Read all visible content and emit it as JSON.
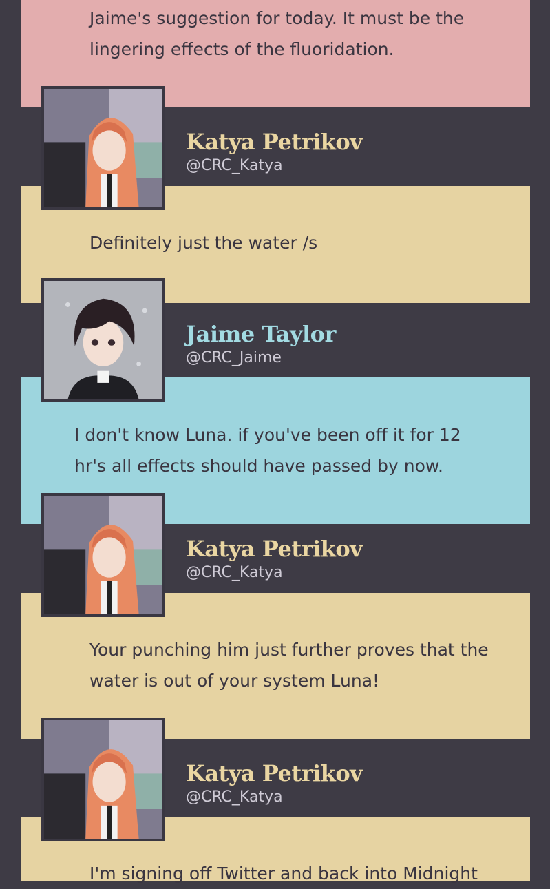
{
  "colors": {
    "background": "#3e3b45",
    "pink": "#e3adae",
    "yellow": "#e6d3a2",
    "blue": "#9dd5de",
    "katya_name": "#ead6a2",
    "jaime_name": "#a2dbe3"
  },
  "posts": [
    {
      "text": "Jaime's suggestion for today. It must be the lingering effects of the fluoridation."
    },
    {
      "author": {
        "name": "Katya Petrikov",
        "handle": "@CRC_Katya",
        "avatar": "katya-avatar"
      },
      "text": "Definitely just the water /s"
    },
    {
      "author": {
        "name": "Jaime Taylor",
        "handle": "@CRC_Jaime",
        "avatar": "jaime-avatar"
      },
      "text": "I don't know Luna. if you've been off it for 12 hr's all effects should have passed by now."
    },
    {
      "author": {
        "name": "Katya Petrikov",
        "handle": "@CRC_Katya",
        "avatar": "katya-avatar"
      },
      "text": "Your punching him just further proves that the water is out of your system Luna!"
    },
    {
      "author": {
        "name": "Katya Petrikov",
        "handle": "@CRC_Katya",
        "avatar": "katya-avatar"
      },
      "text": "I'm signing off Twitter and back into Midnight"
    }
  ]
}
